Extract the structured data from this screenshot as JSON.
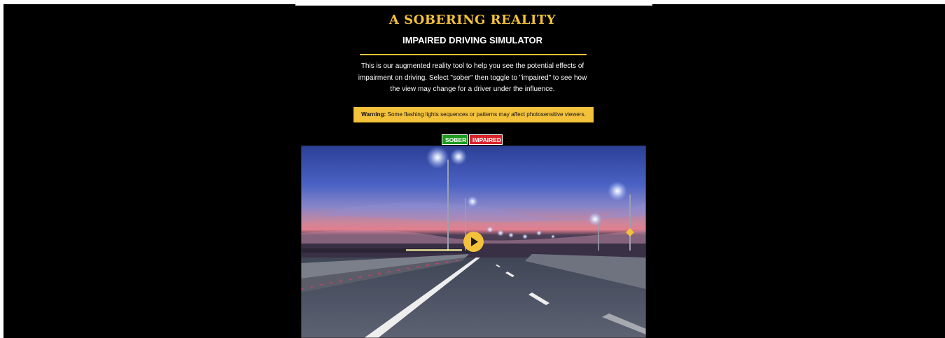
{
  "header": {
    "title": "A SOBERING REALITY",
    "subtitle": "IMPAIRED DRIVING SIMULATOR"
  },
  "intro": {
    "text": "This is our augmented reality tool to help you see the potential effects of impairment on driving. Select \"sober\" then toggle to \"impaired\" to see how the view may change for a driver under the influence."
  },
  "warning": {
    "label": "Warning:",
    "text": "Some flashing lights sequences or patterns may affect photosensitive viewers."
  },
  "toggles": {
    "sober_label": "SOBER",
    "impaired_label": "IMPAIRED"
  },
  "video": {
    "scene": "night highway with street lights under dusk sky",
    "play_icon": "play-icon"
  },
  "colors": {
    "accent": "#f3c13a",
    "sober": "#1f9a1f",
    "impaired": "#d9232a",
    "background": "#000000"
  }
}
